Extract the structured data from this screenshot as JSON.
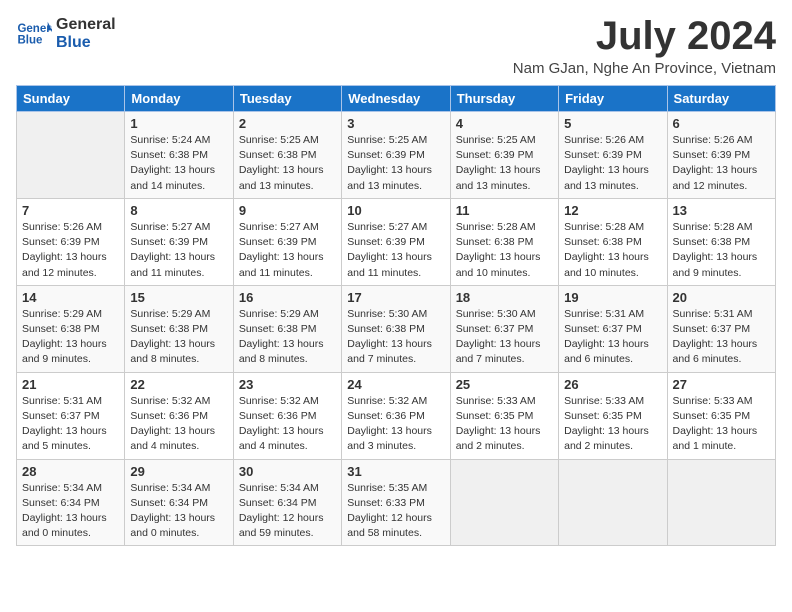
{
  "logo": {
    "line1": "General",
    "line2": "Blue"
  },
  "title": "July 2024",
  "location": "Nam GJan, Nghe An Province, Vietnam",
  "days_of_week": [
    "Sunday",
    "Monday",
    "Tuesday",
    "Wednesday",
    "Thursday",
    "Friday",
    "Saturday"
  ],
  "weeks": [
    [
      {
        "day": "",
        "text": ""
      },
      {
        "day": "1",
        "text": "Sunrise: 5:24 AM\nSunset: 6:38 PM\nDaylight: 13 hours\nand 14 minutes."
      },
      {
        "day": "2",
        "text": "Sunrise: 5:25 AM\nSunset: 6:38 PM\nDaylight: 13 hours\nand 13 minutes."
      },
      {
        "day": "3",
        "text": "Sunrise: 5:25 AM\nSunset: 6:39 PM\nDaylight: 13 hours\nand 13 minutes."
      },
      {
        "day": "4",
        "text": "Sunrise: 5:25 AM\nSunset: 6:39 PM\nDaylight: 13 hours\nand 13 minutes."
      },
      {
        "day": "5",
        "text": "Sunrise: 5:26 AM\nSunset: 6:39 PM\nDaylight: 13 hours\nand 13 minutes."
      },
      {
        "day": "6",
        "text": "Sunrise: 5:26 AM\nSunset: 6:39 PM\nDaylight: 13 hours\nand 12 minutes."
      }
    ],
    [
      {
        "day": "7",
        "text": "Sunrise: 5:26 AM\nSunset: 6:39 PM\nDaylight: 13 hours\nand 12 minutes."
      },
      {
        "day": "8",
        "text": "Sunrise: 5:27 AM\nSunset: 6:39 PM\nDaylight: 13 hours\nand 11 minutes."
      },
      {
        "day": "9",
        "text": "Sunrise: 5:27 AM\nSunset: 6:39 PM\nDaylight: 13 hours\nand 11 minutes."
      },
      {
        "day": "10",
        "text": "Sunrise: 5:27 AM\nSunset: 6:39 PM\nDaylight: 13 hours\nand 11 minutes."
      },
      {
        "day": "11",
        "text": "Sunrise: 5:28 AM\nSunset: 6:38 PM\nDaylight: 13 hours\nand 10 minutes."
      },
      {
        "day": "12",
        "text": "Sunrise: 5:28 AM\nSunset: 6:38 PM\nDaylight: 13 hours\nand 10 minutes."
      },
      {
        "day": "13",
        "text": "Sunrise: 5:28 AM\nSunset: 6:38 PM\nDaylight: 13 hours\nand 9 minutes."
      }
    ],
    [
      {
        "day": "14",
        "text": "Sunrise: 5:29 AM\nSunset: 6:38 PM\nDaylight: 13 hours\nand 9 minutes."
      },
      {
        "day": "15",
        "text": "Sunrise: 5:29 AM\nSunset: 6:38 PM\nDaylight: 13 hours\nand 8 minutes."
      },
      {
        "day": "16",
        "text": "Sunrise: 5:29 AM\nSunset: 6:38 PM\nDaylight: 13 hours\nand 8 minutes."
      },
      {
        "day": "17",
        "text": "Sunrise: 5:30 AM\nSunset: 6:38 PM\nDaylight: 13 hours\nand 7 minutes."
      },
      {
        "day": "18",
        "text": "Sunrise: 5:30 AM\nSunset: 6:37 PM\nDaylight: 13 hours\nand 7 minutes."
      },
      {
        "day": "19",
        "text": "Sunrise: 5:31 AM\nSunset: 6:37 PM\nDaylight: 13 hours\nand 6 minutes."
      },
      {
        "day": "20",
        "text": "Sunrise: 5:31 AM\nSunset: 6:37 PM\nDaylight: 13 hours\nand 6 minutes."
      }
    ],
    [
      {
        "day": "21",
        "text": "Sunrise: 5:31 AM\nSunset: 6:37 PM\nDaylight: 13 hours\nand 5 minutes."
      },
      {
        "day": "22",
        "text": "Sunrise: 5:32 AM\nSunset: 6:36 PM\nDaylight: 13 hours\nand 4 minutes."
      },
      {
        "day": "23",
        "text": "Sunrise: 5:32 AM\nSunset: 6:36 PM\nDaylight: 13 hours\nand 4 minutes."
      },
      {
        "day": "24",
        "text": "Sunrise: 5:32 AM\nSunset: 6:36 PM\nDaylight: 13 hours\nand 3 minutes."
      },
      {
        "day": "25",
        "text": "Sunrise: 5:33 AM\nSunset: 6:35 PM\nDaylight: 13 hours\nand 2 minutes."
      },
      {
        "day": "26",
        "text": "Sunrise: 5:33 AM\nSunset: 6:35 PM\nDaylight: 13 hours\nand 2 minutes."
      },
      {
        "day": "27",
        "text": "Sunrise: 5:33 AM\nSunset: 6:35 PM\nDaylight: 13 hours\nand 1 minute."
      }
    ],
    [
      {
        "day": "28",
        "text": "Sunrise: 5:34 AM\nSunset: 6:34 PM\nDaylight: 13 hours\nand 0 minutes."
      },
      {
        "day": "29",
        "text": "Sunrise: 5:34 AM\nSunset: 6:34 PM\nDaylight: 13 hours\nand 0 minutes."
      },
      {
        "day": "30",
        "text": "Sunrise: 5:34 AM\nSunset: 6:34 PM\nDaylight: 12 hours\nand 59 minutes."
      },
      {
        "day": "31",
        "text": "Sunrise: 5:35 AM\nSunset: 6:33 PM\nDaylight: 12 hours\nand 58 minutes."
      },
      {
        "day": "",
        "text": ""
      },
      {
        "day": "",
        "text": ""
      },
      {
        "day": "",
        "text": ""
      }
    ]
  ]
}
